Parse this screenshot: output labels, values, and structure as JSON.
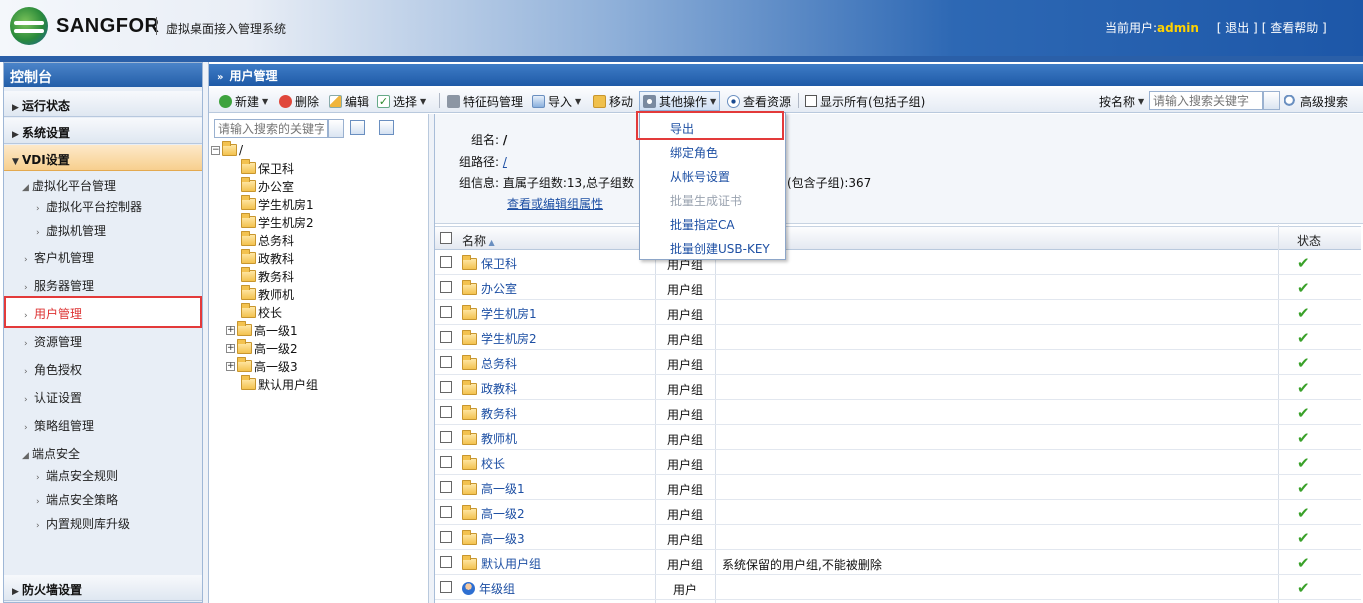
{
  "header": {
    "brand": "SANGFOR",
    "system_name": "虚拟桌面接入管理系统",
    "current_user_label": "当前用户:",
    "current_user": "admin",
    "logout": "[ 退出 ]",
    "help": "[ 查看帮助 ]"
  },
  "sidebar": {
    "title": "控制台",
    "sections": {
      "status": "运行状态",
      "system": "系统设置",
      "vdi": "VDI设置",
      "firewall": "防火墙设置"
    },
    "items": {
      "virt_mgmt": "虚拟化平台管理",
      "virt_ctrl": "虚拟化平台控制器",
      "vm_mgmt": "虚拟机管理",
      "client_mgmt": "客户机管理",
      "server_mgmt": "服务器管理",
      "user_mgmt": "用户管理",
      "resource_mgmt": "资源管理",
      "role_auth": "角色授权",
      "auth_settings": "认证设置",
      "policy_mgmt": "策略组管理",
      "endpoint_security": "端点安全",
      "endpoint_rules": "端点安全规则",
      "endpoint_policy": "端点安全策略",
      "rule_upgrade": "内置规则库升级"
    }
  },
  "main": {
    "title": "用户管理",
    "toolbar": {
      "new": "新建",
      "delete": "删除",
      "edit": "编辑",
      "select": "选择",
      "feature_code": "特征码管理",
      "import": "导入",
      "move": "移动",
      "other_ops": "其他操作",
      "view_resources": "查看资源",
      "show_all": "显示所有(包括子组)",
      "search_by": "按名称",
      "search_placeholder": "请输入搜索关键字",
      "advanced_search": "高级搜索"
    },
    "tree": {
      "search_placeholder": "请输入搜索的关键字",
      "root": "/",
      "nodes": [
        "保卫科",
        "办公室",
        "学生机房1",
        "学生机房2",
        "总务科",
        "政教科",
        "教务科",
        "教师机",
        "校长",
        "高一级1",
        "高一级2",
        "高一级3",
        "默认用户组"
      ]
    },
    "info": {
      "group_name_label": "组名:",
      "group_name": "/",
      "group_path_label": "组路径:",
      "group_path": "/",
      "group_info_label": "组信息:",
      "group_info_left": "直属子组数:13,总子组数",
      "group_info_right": "(包含子组):367",
      "edit_link": "查看或编辑组属性"
    },
    "grid": {
      "col_name": "名称",
      "col_status": "状态",
      "rows": [
        {
          "name": "保卫科",
          "type": "用户组",
          "desc": ""
        },
        {
          "name": "办公室",
          "type": "用户组",
          "desc": ""
        },
        {
          "name": "学生机房1",
          "type": "用户组",
          "desc": ""
        },
        {
          "name": "学生机房2",
          "type": "用户组",
          "desc": ""
        },
        {
          "name": "总务科",
          "type": "用户组",
          "desc": ""
        },
        {
          "name": "政教科",
          "type": "用户组",
          "desc": ""
        },
        {
          "name": "教务科",
          "type": "用户组",
          "desc": ""
        },
        {
          "name": "教师机",
          "type": "用户组",
          "desc": ""
        },
        {
          "name": "校长",
          "type": "用户组",
          "desc": ""
        },
        {
          "name": "高一级1",
          "type": "用户组",
          "desc": ""
        },
        {
          "name": "高一级2",
          "type": "用户组",
          "desc": ""
        },
        {
          "name": "高一级3",
          "type": "用户组",
          "desc": ""
        },
        {
          "name": "默认用户组",
          "type": "用户组",
          "desc": "系统保留的用户组,不能被删除"
        },
        {
          "name": "年级组",
          "type": "用户",
          "desc": ""
        }
      ],
      "status_glyph": "✔"
    },
    "dropdown": {
      "export": "导出",
      "bind_role": "绑定角色",
      "from_account": "从帐号设置",
      "batch_cert": "批量生成证书",
      "batch_ca": "批量指定CA",
      "batch_usbkey": "批量创建USB-KEY"
    }
  }
}
